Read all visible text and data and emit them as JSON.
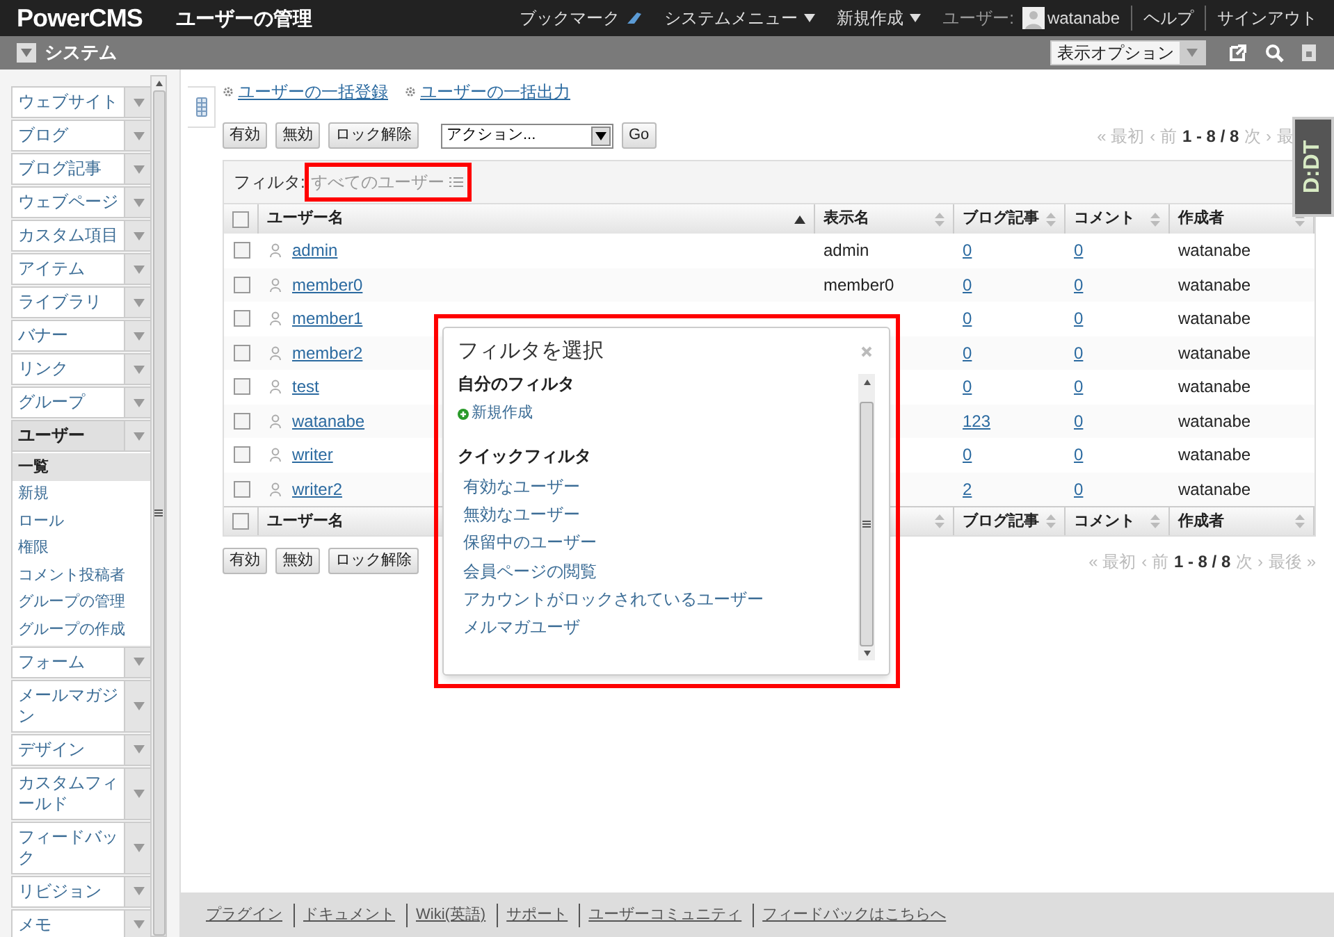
{
  "header": {
    "logo": "PowerCMS",
    "page_title": "ユーザーの管理",
    "menu": [
      {
        "label": "ブックマーク",
        "kind": "bookmark"
      },
      {
        "label": "システムメニュー",
        "kind": "dropdown"
      },
      {
        "label": "新規作成",
        "kind": "dropdown"
      }
    ],
    "user_label": "ユーザー:",
    "user_name": "watanabe",
    "links": [
      "ヘルプ",
      "サインアウト"
    ]
  },
  "scope_bar": {
    "title": "システム",
    "display_options": "表示オプション"
  },
  "sidebar": {
    "items": [
      {
        "label": "ウェブサイト",
        "expanded": false
      },
      {
        "label": "ブログ",
        "expanded": false
      },
      {
        "label": "ブログ記事",
        "expanded": false
      },
      {
        "label": "ウェブページ",
        "expanded": false
      },
      {
        "label": "カスタム項目",
        "expanded": false
      },
      {
        "label": "アイテム",
        "expanded": false
      },
      {
        "label": "ライブラリ",
        "expanded": false
      },
      {
        "label": "バナー",
        "expanded": false
      },
      {
        "label": "リンク",
        "expanded": false
      },
      {
        "label": "グループ",
        "expanded": false
      },
      {
        "label": "ユーザー",
        "expanded": true,
        "children": [
          {
            "label": "一覧",
            "selected": true
          },
          {
            "label": "新規",
            "selected": false
          },
          {
            "label": "ロール",
            "selected": false
          },
          {
            "label": "権限",
            "selected": false
          },
          {
            "label": "コメント投稿者",
            "selected": false
          },
          {
            "label": "グループの管理",
            "selected": false
          },
          {
            "label": "グループの作成",
            "selected": false
          }
        ]
      },
      {
        "label": "フォーム",
        "expanded": false
      },
      {
        "label": "メールマガジン",
        "expanded": false
      },
      {
        "label": "デザイン",
        "expanded": false
      },
      {
        "label": "カスタムフィールド",
        "expanded": false
      },
      {
        "label": "フィードバック",
        "expanded": false
      },
      {
        "label": "リビジョン",
        "expanded": false
      },
      {
        "label": "メモ",
        "expanded": false
      }
    ]
  },
  "action_links": [
    "ユーザーの一括登録",
    "ユーザーの一括出力"
  ],
  "toolbar": {
    "buttons": [
      "有効",
      "無効",
      "ロック解除"
    ],
    "action_select": "アクション...",
    "go": "Go"
  },
  "pagination_top": {
    "first": "« 最初",
    "prev": "‹ 前",
    "range": "1 - 8 / 8",
    "next": "次 ›",
    "last": "最"
  },
  "filter": {
    "label": "フィルタ:",
    "value": "すべてのユーザー"
  },
  "table": {
    "header_checked": false,
    "footer_checked": false,
    "columns": [
      {
        "label": "ユーザー名",
        "sorted": true
      },
      {
        "label": "表示名",
        "sorted": false
      },
      {
        "label": "ブログ記事",
        "sorted": false
      },
      {
        "label": "コメント",
        "sorted": false
      },
      {
        "label": "作成者",
        "sorted": false
      }
    ],
    "rows": [
      {
        "username": "admin",
        "display_name": "admin",
        "blog_entries": "0",
        "comments": "0",
        "author": "watanabe",
        "checked": false
      },
      {
        "username": "member0",
        "display_name": "member0",
        "blog_entries": "0",
        "comments": "0",
        "author": "watanabe",
        "checked": false
      },
      {
        "username": "member1",
        "blog_entries": "0",
        "comments": "0",
        "author": "watanabe",
        "checked": false
      },
      {
        "username": "member2",
        "blog_entries": "0",
        "comments": "0",
        "author": "watanabe",
        "checked": false
      },
      {
        "username": "test",
        "blog_entries": "0",
        "comments": "0",
        "author": "watanabe",
        "checked": false
      },
      {
        "username": "watanabe",
        "blog_entries": "123",
        "comments": "0",
        "author": "watanabe",
        "checked": false
      },
      {
        "username": "writer",
        "blog_entries": "0",
        "comments": "0",
        "author": "watanabe",
        "checked": false
      },
      {
        "username": "writer2",
        "blog_entries": "2",
        "comments": "0",
        "author": "watanabe",
        "checked": false
      }
    ],
    "footer_columns": [
      {
        "label": "ユーザー名"
      },
      {
        "sorted": false
      },
      {
        "label": "ブログ記事",
        "sorted": false
      },
      {
        "label": "コメント",
        "sorted": false
      },
      {
        "label": "作成者",
        "sorted": false
      }
    ]
  },
  "bottom_toolbar": {
    "buttons": [
      "有効",
      "無効",
      "ロック解除"
    ]
  },
  "pagination_bottom": {
    "first": "« 最初",
    "prev": "‹ 前",
    "range": "1 - 8 / 8",
    "next": "次 ›",
    "last": "最後 »"
  },
  "filter_dialog": {
    "title": "フィルタを選択",
    "sections": [
      {
        "title": "自分のフィルタ",
        "items": [
          {
            "label": "新規作成",
            "kind": "create"
          }
        ]
      },
      {
        "title": "クイックフィルタ",
        "items": [
          {
            "label": "有効なユーザー",
            "kind": "filter"
          },
          {
            "label": "無効なユーザー",
            "kind": "filter"
          },
          {
            "label": "保留中のユーザー",
            "kind": "filter"
          },
          {
            "label": "会員ページの閲覧",
            "kind": "filter"
          },
          {
            "label": "アカウントがロックされているユーザー",
            "kind": "filter"
          },
          {
            "label": "メルマガユーザ",
            "kind": "filter"
          }
        ]
      }
    ]
  },
  "badge": "D:DT",
  "footer": {
    "links": [
      "プラグイン",
      "ドキュメント",
      "Wiki(英語)",
      "サポート",
      "ユーザーコミュニティ",
      "フィードバックはこちらへ"
    ]
  }
}
